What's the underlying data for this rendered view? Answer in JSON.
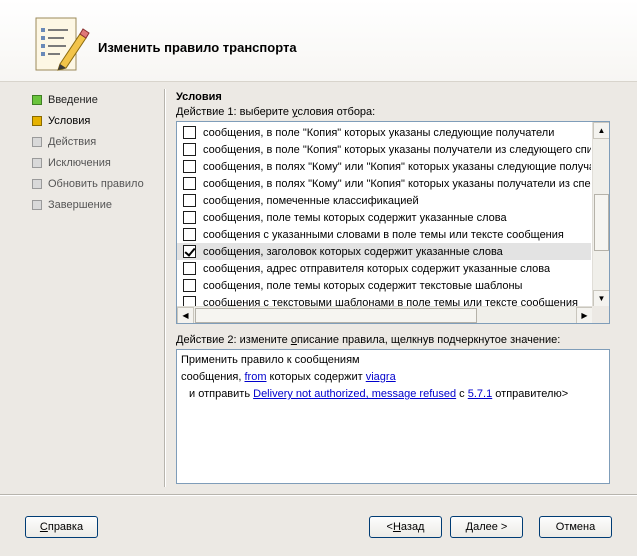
{
  "header": {
    "title": "Изменить правило транспорта"
  },
  "steps": [
    {
      "label": "Введение",
      "status": "done",
      "color": "#6ac43c"
    },
    {
      "label": "Условия",
      "status": "current",
      "color": "#e6b200"
    },
    {
      "label": "Действия",
      "status": "pending",
      "color": "#d9d9d9"
    },
    {
      "label": "Исключения",
      "status": "pending",
      "color": "#d9d9d9"
    },
    {
      "label": "Обновить правило",
      "status": "pending",
      "color": "#d9d9d9"
    },
    {
      "label": "Завершение",
      "status": "pending",
      "color": "#d9d9d9"
    }
  ],
  "conditions": {
    "title": "Условия",
    "step1_prefix": "Действие 1: выберите ",
    "step1_u": "у",
    "step1_suffix": "словия отбора:",
    "items": [
      {
        "text": "сообщения, в поле \"Копия\" которых указаны следующие получатели",
        "checked": false
      },
      {
        "text": "сообщения, в поле \"Копия\" которых указаны получатели из следующего спи",
        "checked": false
      },
      {
        "text": "сообщения, в полях \"Кому\" или \"Копия\" которых указаны следующие получа",
        "checked": false
      },
      {
        "text": "сообщения, в полях \"Кому\" или \"Копия\" которых указаны получатели из спе",
        "checked": false
      },
      {
        "text": "сообщения, помеченные классификацией",
        "checked": false
      },
      {
        "text": "сообщения, поле темы которых содержит указанные слова",
        "checked": false
      },
      {
        "text": "сообщения с указанными словами в поле темы или тексте сообщения",
        "checked": false
      },
      {
        "text": "сообщения, заголовок которых содержит указанные слова",
        "checked": true
      },
      {
        "text": "сообщения, адрес отправителя которых содержит указанные слова",
        "checked": false
      },
      {
        "text": "сообщения, поле темы которых содержит текстовые шаблоны",
        "checked": false
      },
      {
        "text": "сообщения с текстовыми шаблонами в поле темы или тексте сообщения",
        "checked": false
      }
    ]
  },
  "description": {
    "step2_prefix": "Действие 2: измените ",
    "step2_u": "о",
    "step2_suffix": "писание правила, щелкнув подчеркнутое значение:",
    "line1": "Применить правило к сообщениям",
    "line2_a": "сообщения, ",
    "line2_link1": "from",
    "line2_b": " которых содержит ",
    "line2_link2": "viagra",
    "line3_a": "и отправить ",
    "line3_link1": "Delivery not authorized, message refused",
    "line3_b": " с ",
    "line3_link2": "5.7.1",
    "line3_c": " отправителю>"
  },
  "buttons": {
    "help_u": "С",
    "help_rest": "правка",
    "back_pre": "< ",
    "back_u": "Н",
    "back_rest": "азад",
    "next_u": "Д",
    "next_rest": "алее >",
    "cancel": "Отмена"
  }
}
